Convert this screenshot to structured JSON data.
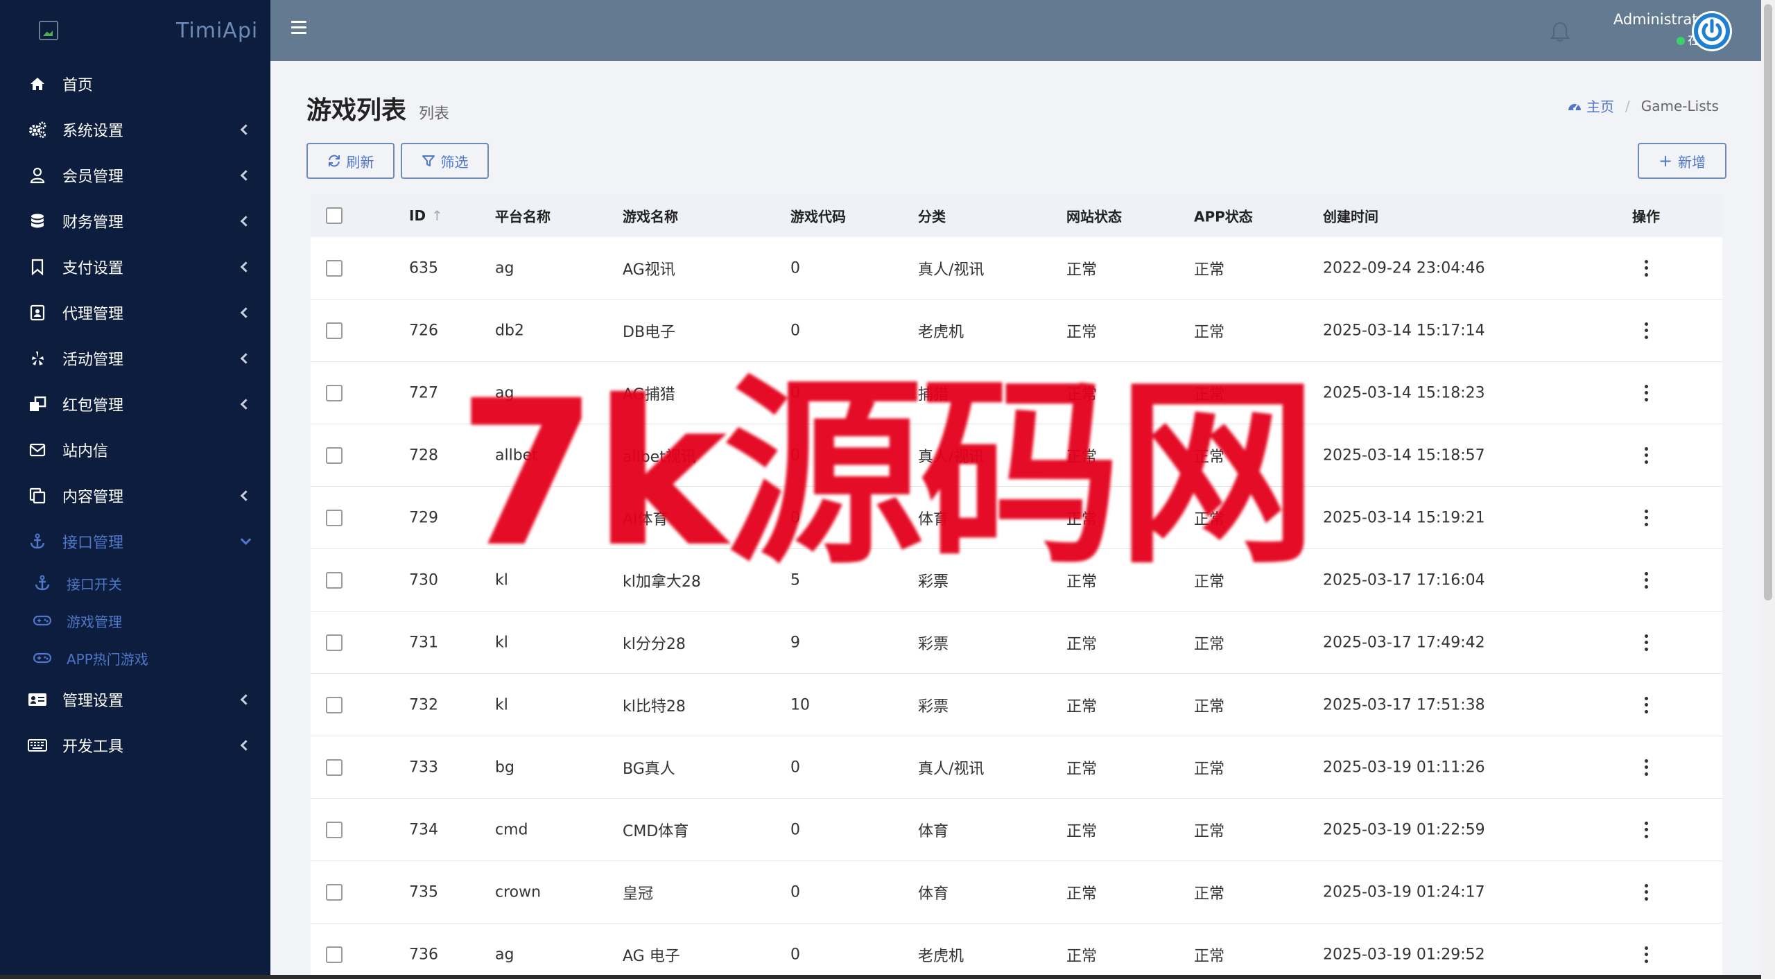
{
  "brand": {
    "name": "TimiApi"
  },
  "sidebar": {
    "items": [
      {
        "label": "首页",
        "icon": "home-icon",
        "caret": false
      },
      {
        "label": "系统设置",
        "icon": "cogs-icon",
        "caret": true
      },
      {
        "label": "会员管理",
        "icon": "user-icon",
        "caret": true
      },
      {
        "label": "财务管理",
        "icon": "database-icon",
        "caret": true
      },
      {
        "label": "支付设置",
        "icon": "bookmark-icon",
        "caret": true
      },
      {
        "label": "代理管理",
        "icon": "contact-card-icon",
        "caret": true
      },
      {
        "label": "活动管理",
        "icon": "yelp-icon",
        "caret": true
      },
      {
        "label": "红包管理",
        "icon": "clone-icon",
        "caret": true
      },
      {
        "label": "站内信",
        "icon": "envelope-icon",
        "caret": false
      },
      {
        "label": "内容管理",
        "icon": "copy-icon",
        "caret": true
      },
      {
        "label": "接口管理",
        "icon": "anchor-icon",
        "caret": true,
        "active": true
      },
      {
        "label": "管理设置",
        "icon": "id-card-icon",
        "caret": true
      },
      {
        "label": "开发工具",
        "icon": "keyboard-icon",
        "caret": true
      }
    ],
    "submenu": [
      {
        "label": "接口开关",
        "icon": "anchor-icon"
      },
      {
        "label": "游戏管理",
        "icon": "gamepad-icon"
      },
      {
        "label": "APP热门游戏",
        "icon": "gamepad-icon"
      }
    ]
  },
  "header": {
    "user_name": "Administrator",
    "user_status": "在线",
    "status_color": "#3ccf6a"
  },
  "page": {
    "title": "游戏列表",
    "subtitle": "列表",
    "breadcrumb_home": "主页",
    "breadcrumb_current": "Game-Lists"
  },
  "toolbar": {
    "refresh_label": "刷新",
    "filter_label": "筛选",
    "add_label": "新增"
  },
  "table": {
    "headers": {
      "id": "ID",
      "platform": "平台名称",
      "game_name": "游戏名称",
      "game_code": "游戏代码",
      "category": "分类",
      "web_status": "网站状态",
      "app_status": "APP状态",
      "created_at": "创建时间",
      "actions": "操作"
    },
    "rows": [
      {
        "id": "635",
        "platform": "ag",
        "game_name": "AG视讯",
        "game_code": "0",
        "category": "真人/视讯",
        "web_status": "正常",
        "app_status": "正常",
        "created_at": "2022-09-24 23:04:46"
      },
      {
        "id": "726",
        "platform": "db2",
        "game_name": "DB电子",
        "game_code": "0",
        "category": "老虎机",
        "web_status": "正常",
        "app_status": "正常",
        "created_at": "2025-03-14 15:17:14"
      },
      {
        "id": "727",
        "platform": "ag",
        "game_name": "AG捕猎",
        "game_code": "0",
        "category": "捕猎",
        "web_status": "正常",
        "app_status": "正常",
        "created_at": "2025-03-14 15:18:23"
      },
      {
        "id": "728",
        "platform": "allbet",
        "game_name": "allbet视讯",
        "game_code": "0",
        "category": "真人/视讯",
        "web_status": "正常",
        "app_status": "正常",
        "created_at": "2025-03-14 15:18:57"
      },
      {
        "id": "729",
        "platform": "",
        "game_name": "AI体育",
        "game_code": "0",
        "category": "体育",
        "web_status": "正常",
        "app_status": "正常",
        "created_at": "2025-03-14 15:19:21"
      },
      {
        "id": "730",
        "platform": "kl",
        "game_name": "kl加拿大28",
        "game_code": "5",
        "category": "彩票",
        "web_status": "正常",
        "app_status": "正常",
        "created_at": "2025-03-17 17:16:04"
      },
      {
        "id": "731",
        "platform": "kl",
        "game_name": "kl分分28",
        "game_code": "9",
        "category": "彩票",
        "web_status": "正常",
        "app_status": "正常",
        "created_at": "2025-03-17 17:49:42"
      },
      {
        "id": "732",
        "platform": "kl",
        "game_name": "kl比特28",
        "game_code": "10",
        "category": "彩票",
        "web_status": "正常",
        "app_status": "正常",
        "created_at": "2025-03-17 17:51:38"
      },
      {
        "id": "733",
        "platform": "bg",
        "game_name": "BG真人",
        "game_code": "0",
        "category": "真人/视讯",
        "web_status": "正常",
        "app_status": "正常",
        "created_at": "2025-03-19 01:11:26"
      },
      {
        "id": "734",
        "platform": "cmd",
        "game_name": "CMD体育",
        "game_code": "0",
        "category": "体育",
        "web_status": "正常",
        "app_status": "正常",
        "created_at": "2025-03-19 01:22:59"
      },
      {
        "id": "735",
        "platform": "crown",
        "game_name": "皇冠",
        "game_code": "0",
        "category": "体育",
        "web_status": "正常",
        "app_status": "正常",
        "created_at": "2025-03-19 01:24:17"
      },
      {
        "id": "736",
        "platform": "ag",
        "game_name": "AG 电子",
        "game_code": "0",
        "category": "老虎机",
        "web_status": "正常",
        "app_status": "正常",
        "created_at": "2025-03-19 01:29:52"
      }
    ]
  },
  "watermark": {
    "text": "7k源码网",
    "color": "#e3001b"
  }
}
